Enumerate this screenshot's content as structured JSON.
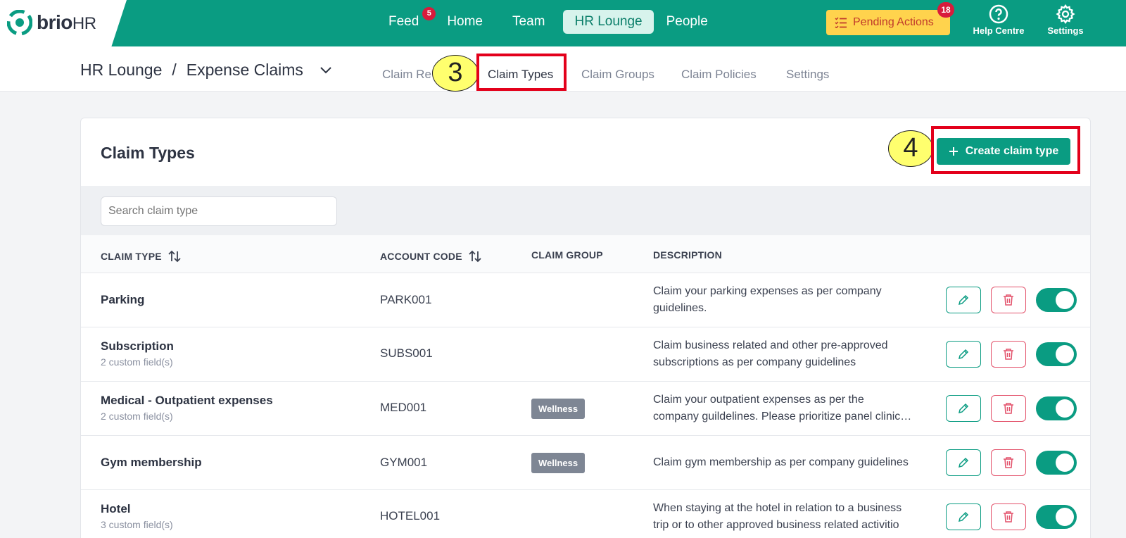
{
  "brand": {
    "name": "brio",
    "suffix": "HR"
  },
  "topnav": {
    "items": [
      {
        "label": "Feed",
        "badge": "5"
      },
      {
        "label": "Home"
      },
      {
        "label": "Team"
      },
      {
        "label": "HR Lounge",
        "active": true
      },
      {
        "label": "People"
      }
    ],
    "pending": {
      "label": "Pending Actions",
      "badge": "18"
    },
    "help": "Help Centre",
    "settings": "Settings"
  },
  "breadcrumb": {
    "root": "HR Lounge",
    "separator": "/",
    "current": "Expense Claims"
  },
  "subtabs": [
    "Claim Re",
    "Claim Types",
    "Claim Groups",
    "Claim Policies",
    "Settings"
  ],
  "annotations": {
    "step3": "3",
    "step4": "4"
  },
  "card": {
    "title": "Claim Types",
    "create_label": "Create claim type",
    "search_placeholder": "Search claim type"
  },
  "table": {
    "headers": [
      "CLAIM TYPE",
      "ACCOUNT CODE",
      "CLAIM GROUP",
      "DESCRIPTION"
    ],
    "rows": [
      {
        "name": "Parking",
        "sub": "",
        "code": "PARK001",
        "group": "",
        "desc1": "Claim your parking expenses as per company",
        "desc2": "guidelines."
      },
      {
        "name": "Subscription",
        "sub": "2 custom field(s)",
        "code": "SUBS001",
        "group": "",
        "desc1": "Claim business related and other pre-approved",
        "desc2": "subscriptions as per company guidelines"
      },
      {
        "name": "Medical - Outpatient expenses",
        "sub": "2 custom field(s)",
        "code": "MED001",
        "group": "Wellness",
        "desc1": "Claim your outpatient expenses as per the",
        "desc2": "company guildelines. Please prioritize panel clinic…"
      },
      {
        "name": "Gym membership",
        "sub": "",
        "code": "GYM001",
        "group": "Wellness",
        "desc1": "Claim gym membership as per company guidelines",
        "desc2": ""
      },
      {
        "name": "Hotel",
        "sub": "3 custom field(s)",
        "code": "HOTEL001",
        "group": "",
        "desc1": "When staying at the hotel in relation to a business",
        "desc2": "trip or to other approved business related activitio"
      }
    ]
  },
  "colors": {
    "primary": "#0a9c82",
    "danger": "#e3526b",
    "pending": "#ffd34d",
    "annotation": "#e3001b"
  }
}
